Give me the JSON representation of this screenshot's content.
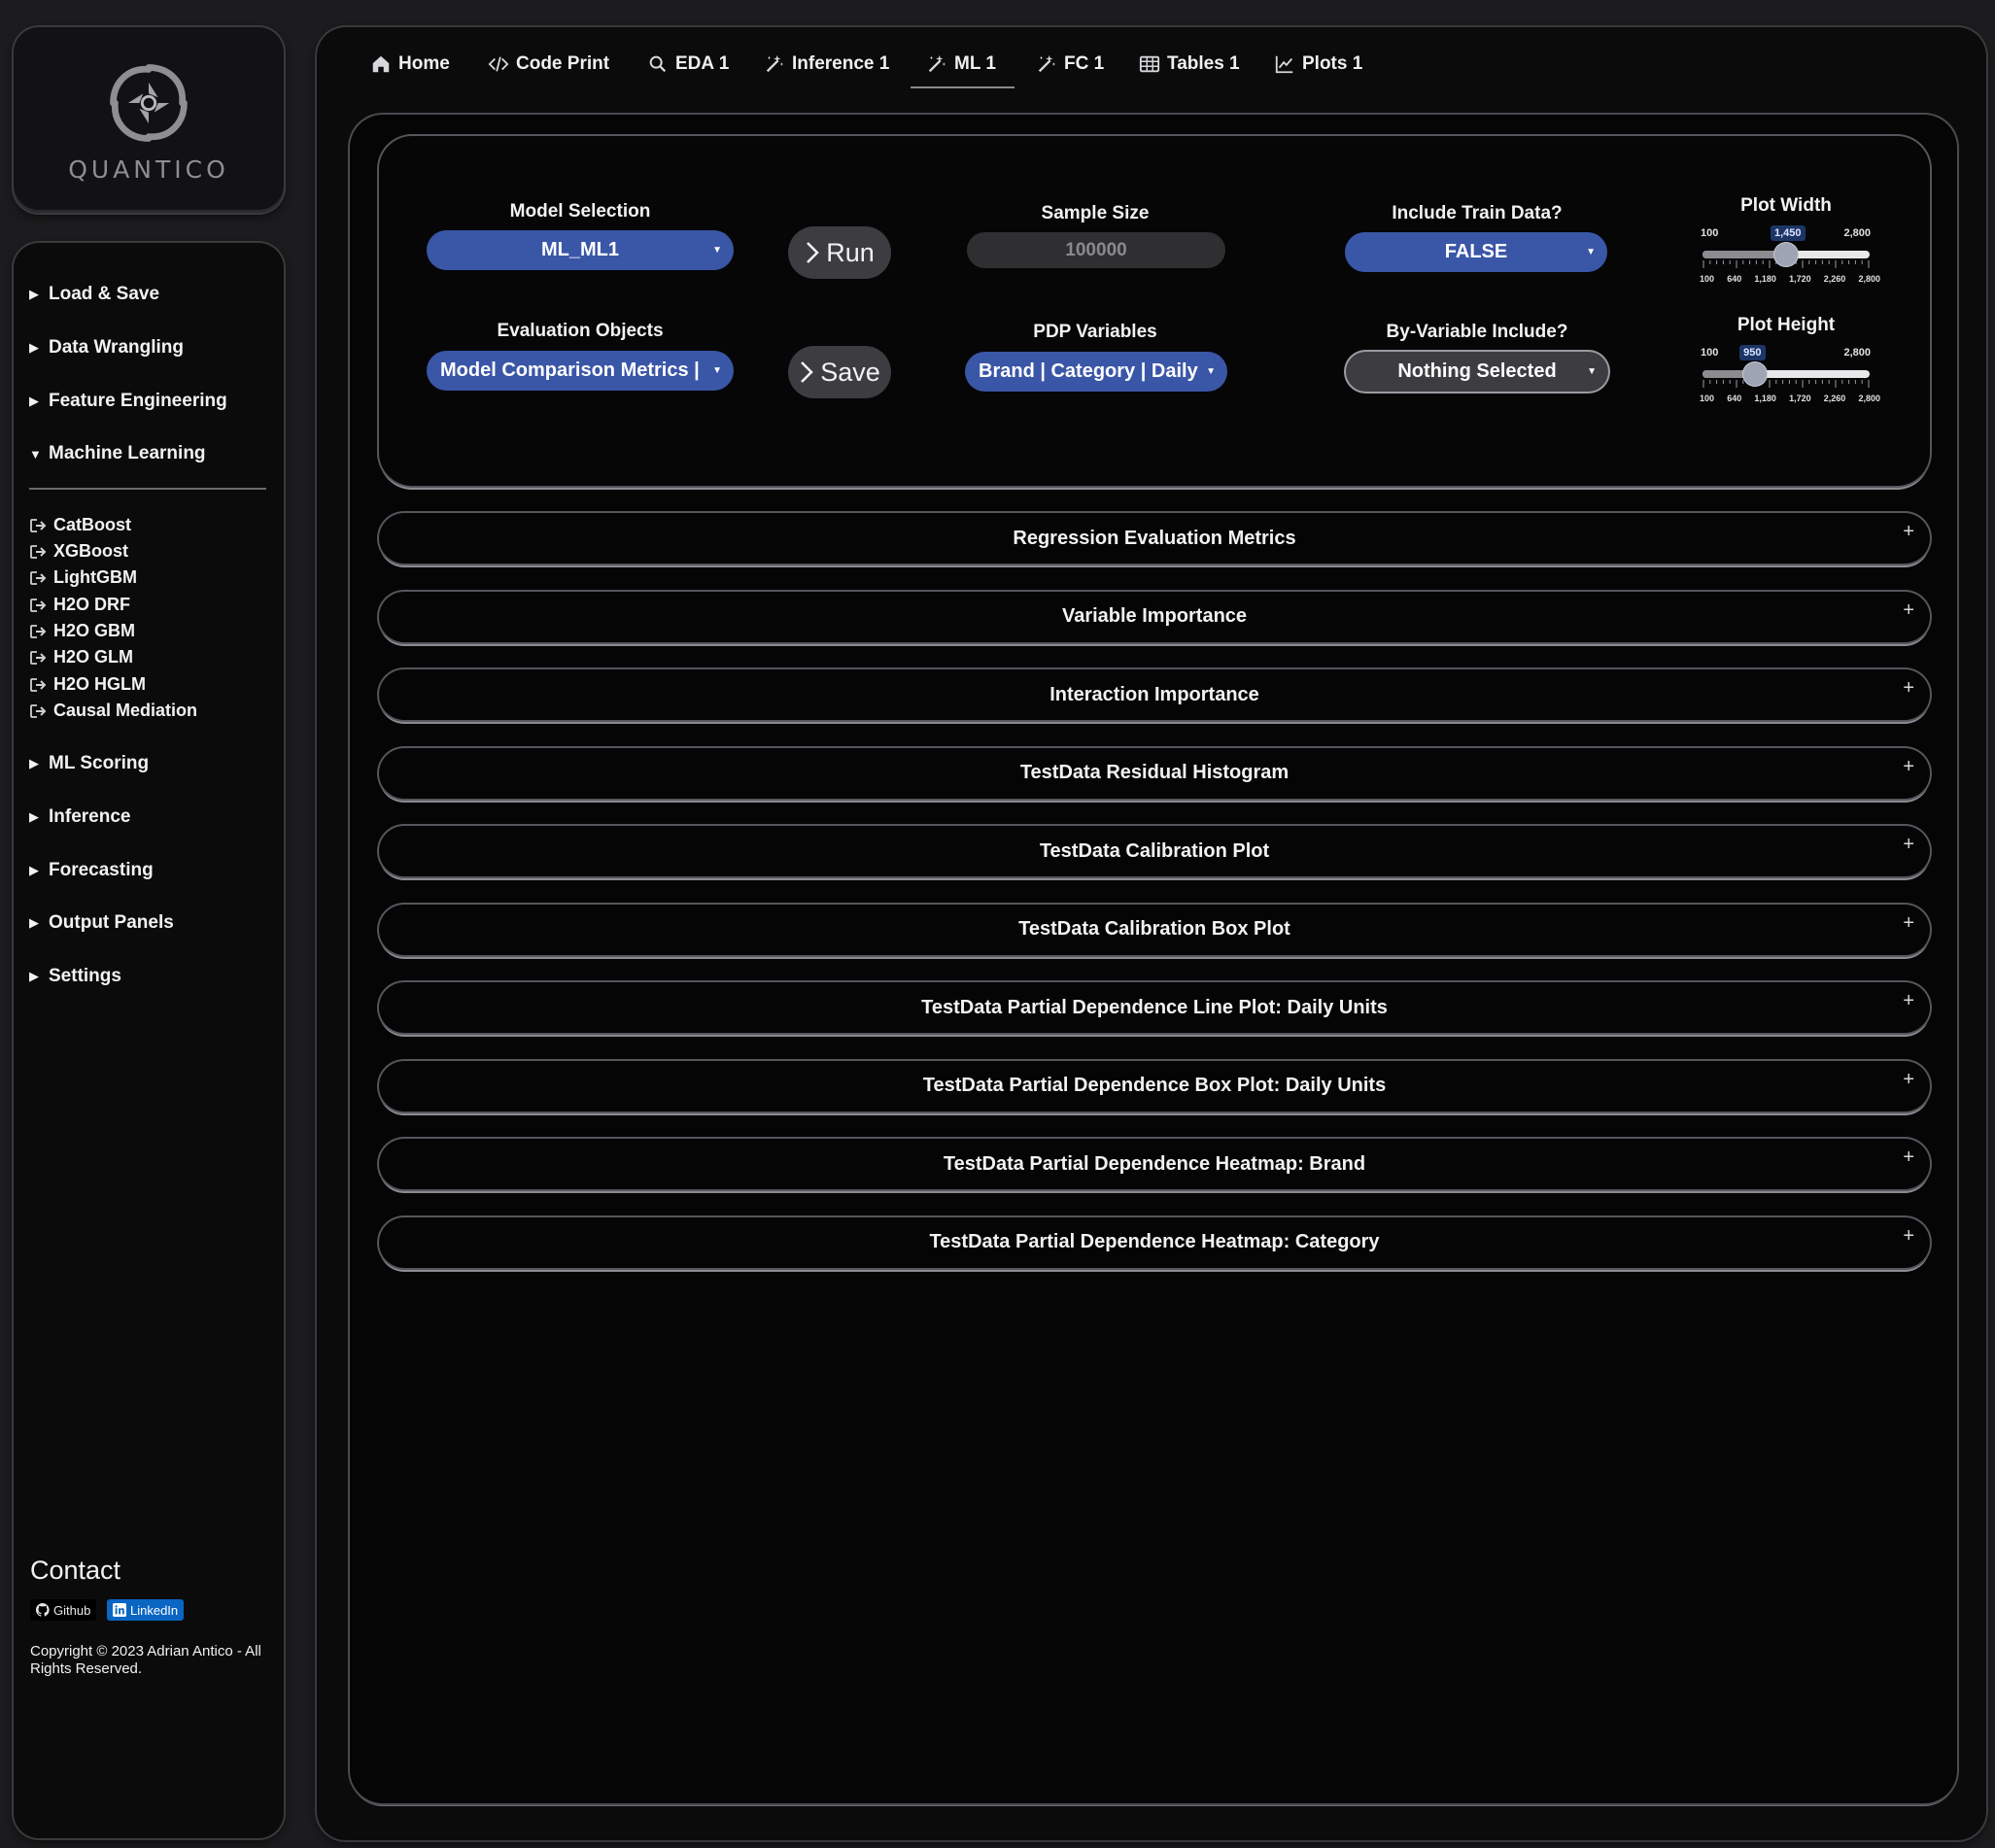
{
  "brand": {
    "logo_text": "QUANTICO"
  },
  "sidebar": {
    "sections_top": [
      {
        "label": "Load & Save"
      },
      {
        "label": "Data Wrangling"
      },
      {
        "label": "Feature Engineering"
      },
      {
        "label": "Machine Learning",
        "expanded": true
      }
    ],
    "ml_items": [
      {
        "label": "CatBoost"
      },
      {
        "label": "XGBoost"
      },
      {
        "label": "LightGBM"
      },
      {
        "label": "H2O DRF"
      },
      {
        "label": "H2O GBM"
      },
      {
        "label": "H2O GLM"
      },
      {
        "label": "H2O HGLM"
      },
      {
        "label": "Causal Mediation"
      }
    ],
    "sections_bottom": [
      {
        "label": "ML Scoring"
      },
      {
        "label": "Inference"
      },
      {
        "label": "Forecasting"
      },
      {
        "label": "Output Panels"
      },
      {
        "label": "Settings"
      }
    ],
    "contact": {
      "title": "Contact",
      "github_label": "Github",
      "linkedin_label": "LinkedIn",
      "copyright": "Copyright © 2023 Adrian Antico - All Rights Reserved."
    }
  },
  "tabs": [
    {
      "label": "Home",
      "icon": "home-icon"
    },
    {
      "label": "Code Print",
      "icon": "code-icon"
    },
    {
      "label": "EDA 1",
      "icon": "search-icon"
    },
    {
      "label": "Inference 1",
      "icon": "magic-wand-icon"
    },
    {
      "label": "ML 1",
      "icon": "magic-wand-icon",
      "active": true
    },
    {
      "label": "FC 1",
      "icon": "magic-wand-icon"
    },
    {
      "label": "Tables 1",
      "icon": "table-icon"
    },
    {
      "label": "Plots 1",
      "icon": "line-chart-icon"
    }
  ],
  "controls": {
    "model_selection": {
      "label": "Model Selection",
      "value": "ML_ML1"
    },
    "evaluation_objects": {
      "label": "Evaluation Objects",
      "value": "Model Comparison Metrics |"
    },
    "run_label": "Run",
    "save_label": "Save",
    "sample_size": {
      "label": "Sample Size",
      "value": "100000"
    },
    "pdp_variables": {
      "label": "PDP Variables",
      "value": "Brand | Category | Daily"
    },
    "include_train": {
      "label": "Include Train Data?",
      "value": "FALSE"
    },
    "by_variable": {
      "label": "By-Variable Include?",
      "value": "Nothing Selected"
    },
    "plot_width": {
      "label": "Plot Width",
      "min": "100",
      "max": "2,800",
      "value": "1,450",
      "value_num": 1450,
      "range": [
        100,
        2800
      ],
      "grid": [
        "100",
        "640",
        "1,180",
        "1,720",
        "2,260",
        "2,800"
      ]
    },
    "plot_height": {
      "label": "Plot Height",
      "min": "100",
      "max": "2,800",
      "value": "950",
      "value_num": 950,
      "range": [
        100,
        2800
      ],
      "grid": [
        "100",
        "640",
        "1,180",
        "1,720",
        "2,260",
        "2,800"
      ]
    }
  },
  "panels": [
    {
      "title": "Regression Evaluation Metrics"
    },
    {
      "title": "Variable Importance"
    },
    {
      "title": "Interaction Importance"
    },
    {
      "title": "TestData Residual Histogram"
    },
    {
      "title": "TestData Calibration Plot"
    },
    {
      "title": "TestData Calibration Box Plot"
    },
    {
      "title": "TestData Partial Dependence Line Plot: Daily Units"
    },
    {
      "title": "TestData Partial Dependence Box Plot: Daily Units"
    },
    {
      "title": "TestData Partial Dependence Heatmap: Brand"
    },
    {
      "title": "TestData Partial Dependence Heatmap: Category"
    }
  ],
  "colors": {
    "accent_blue": "#3a56a7",
    "panel_bg": "#050506"
  }
}
